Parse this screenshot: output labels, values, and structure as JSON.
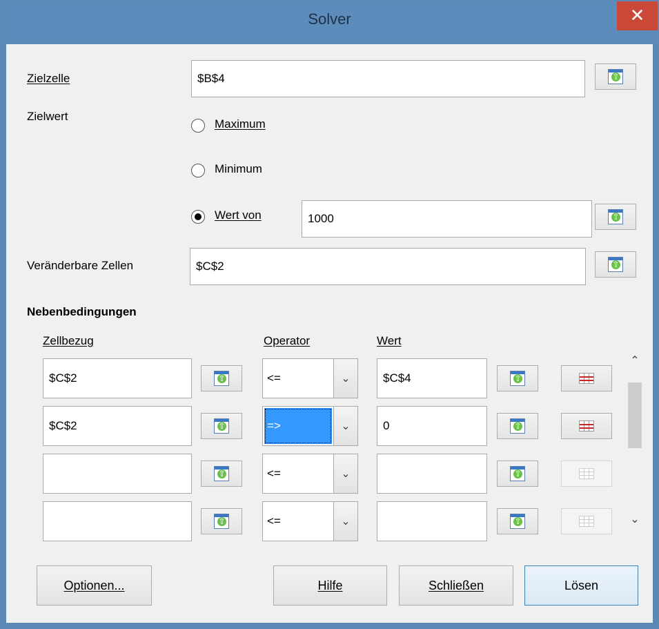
{
  "window": {
    "title": "Solver",
    "close_glyph": "✕"
  },
  "target_cell": {
    "label": "Zielzelle",
    "value": "$B$4"
  },
  "target_value": {
    "label": "Zielwert",
    "options": [
      {
        "label": "Maximum",
        "selected": false
      },
      {
        "label": "Minimum",
        "selected": false
      },
      {
        "label": "Wert von",
        "selected": true
      }
    ],
    "value_of": "1000"
  },
  "changing_cells": {
    "label": "Veränderbare Zellen",
    "value": "$C$2"
  },
  "constraints": {
    "heading": "Nebenbedingungen",
    "col_cell": "Zellbezug",
    "col_operator": "Operator",
    "col_value": "Wert",
    "rows": [
      {
        "cell": "$C$2",
        "operator": "<=",
        "value": "$C$4"
      },
      {
        "cell": "$C$2",
        "operator": "=>",
        "value": "0"
      },
      {
        "cell": "",
        "operator": "<=",
        "value": ""
      },
      {
        "cell": "",
        "operator": "<=",
        "value": ""
      }
    ]
  },
  "buttons": {
    "options": "Optionen...",
    "help": "Hilfe",
    "close": "Schließen",
    "solve": "Lösen"
  },
  "icons": {
    "scroll_up": "⌃",
    "scroll_down": "⌄",
    "dropdown": "⌄"
  },
  "colors": {
    "titlebar": "#5b8cbc",
    "close": "#c94838",
    "selection": "#3399ff"
  }
}
